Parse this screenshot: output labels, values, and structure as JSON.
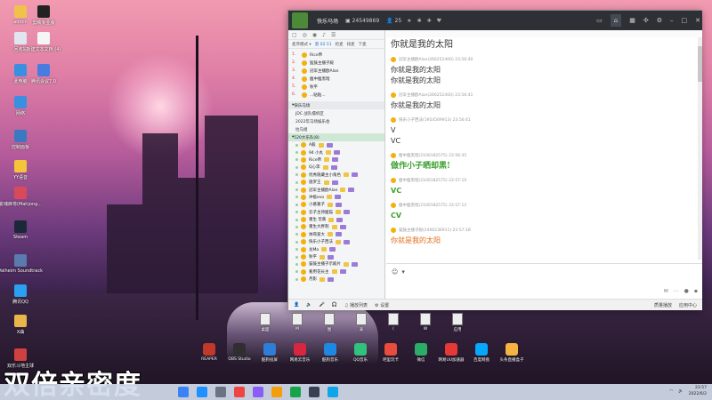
{
  "desktop_icons": [
    {
      "label": "admin",
      "color": "#f0c24a"
    },
    {
      "label": "剪映专业版",
      "color": "#222222"
    },
    {
      "label": "回收站",
      "color": "#dfe6ef"
    },
    {
      "label": "新建文本文档 (4)",
      "color": "#f5f5f5"
    },
    {
      "label": "此电脑",
      "color": "#3b8fe0"
    },
    {
      "label": "腾讯会议7.0",
      "color": "#4a7ce0"
    },
    {
      "label": "网络",
      "color": "#3b8fe0"
    },
    {
      "label": "控制面板",
      "color": "#3a78c2"
    },
    {
      "label": "YY语音",
      "color": "#f4c43a"
    },
    {
      "label": "雀魂麻将(Mahjong...",
      "color": "#d84a5a"
    },
    {
      "label": "Steam",
      "color": "#1b2838"
    },
    {
      "label": "Valheim Soundtrack",
      "color": "#5a7ab0"
    },
    {
      "label": "腾讯QQ",
      "color": "#2aa0f0"
    },
    {
      "label": "X曲",
      "color": "#e8b64a"
    },
    {
      "label": "双乐斗地主球",
      "color": "#d04040"
    }
  ],
  "qq_window": {
    "title": "快乐马场",
    "group_id": "24549869",
    "member_count": "25",
    "left_tabs": [
      "麦序模式 ▾",
      "第 02:11",
      "抢麦",
      "排麦",
      "下麦"
    ],
    "rank_list": [
      {
        "no": "1.",
        "name": "Rice帝"
      },
      {
        "no": "2.",
        "name": "猛鼓主播子殿"
      },
      {
        "no": "3.",
        "name": "冠军主播欧Alan"
      },
      {
        "no": "4.",
        "name": "瘦中瘦黑暗"
      },
      {
        "no": "5.",
        "name": "秋平"
      },
      {
        "no": "6.",
        "name": "...贴贴..."
      }
    ],
    "sections": {
      "head1": "快乐马场",
      "items": [
        "JDC 战队擂机区",
        "2022年马场娱乐会",
        "拉马组"
      ],
      "head2": "520大乐队(8)"
    },
    "members": [
      "A毅",
      "94 小丸",
      "Rice帝",
      "Q心李",
      "优秀隐藏主小角色",
      "施罗王",
      "冠军主播欧Alan",
      "冲极evo",
      "小葛葛子",
      "云子主持瘦猫",
      "重生 荒蕉",
      "重生大胖刺",
      "帅哥爱大",
      "快乐小子西法",
      "龙Ma",
      "秋平",
      "猫鼓主播子示殿片",
      "看用花长主",
      "月影"
    ],
    "messages": [
      {
        "who": "",
        "text": "你就是我的太阳",
        "style": "big"
      },
      {
        "who": "冠军主播欧Alan(266252400)  23:56:40",
        "text": "你就是我的太阳\n你就是我的太阳",
        "style": ""
      },
      {
        "who": "冠军主播欧Alan(266252400)  23:56:41",
        "text": "你就是我的太阳",
        "style": ""
      },
      {
        "who": "快乐小子西法(1954569913)  23:56:41",
        "text": "V\nVC",
        "style": ""
      },
      {
        "who": "瘦中瘦黑暗(2100182575)  23:56:45",
        "text": "做作小子晒却黑!",
        "style": "green"
      },
      {
        "who": "瘦中瘦黑暗(2100182575)  23:57:10",
        "text": "VC",
        "style": "green-bold"
      },
      {
        "who": "瘦中瘦黑暗(2100182575)  23:57:12",
        "text": "CV",
        "style": "green-bold"
      },
      {
        "who": "猫鼓主播子殿(2406236911)  23:57:18",
        "text": "你就是我的太阳",
        "style": "orange"
      }
    ],
    "bottom_bar": {
      "items": [
        "播放列表",
        "设置"
      ],
      "right": [
        "质量播放",
        "应用中心"
      ]
    }
  },
  "dock_files": [
    "桌面",
    "M",
    "图",
    "表",
    "(",
    "W",
    "应用"
  ],
  "apps": [
    {
      "label": "REAPER",
      "color": "#c0392b"
    },
    {
      "label": "OBS Studio",
      "color": "#302e31"
    },
    {
      "label": "酷狗投屏",
      "color": "#2e7dd7"
    },
    {
      "label": "网易云音乐",
      "color": "#d7263d"
    },
    {
      "label": "酷狗音乐",
      "color": "#1e88e5"
    },
    {
      "label": "QQ音乐",
      "color": "#31c27c"
    },
    {
      "label": "吧里玩卡",
      "color": "#e74c3c"
    },
    {
      "label": "微信",
      "color": "#2aae67"
    },
    {
      "label": "网易UU加速器",
      "color": "#e53935"
    },
    {
      "label": "百度网盘",
      "color": "#06a7ff"
    },
    {
      "label": "头条直播盒子",
      "color": "#f5b342"
    }
  ],
  "caption": "双倍亲密度",
  "taskbar": {
    "icon_colors": [
      "#3b82f6",
      "#1e90ff",
      "#6b7280",
      "#ef4444",
      "#8b5cf6",
      "#f59e0b",
      "#16a34a",
      "#374151",
      "#0ea5e9"
    ],
    "time": "23:57",
    "date": "2022/6/2"
  }
}
